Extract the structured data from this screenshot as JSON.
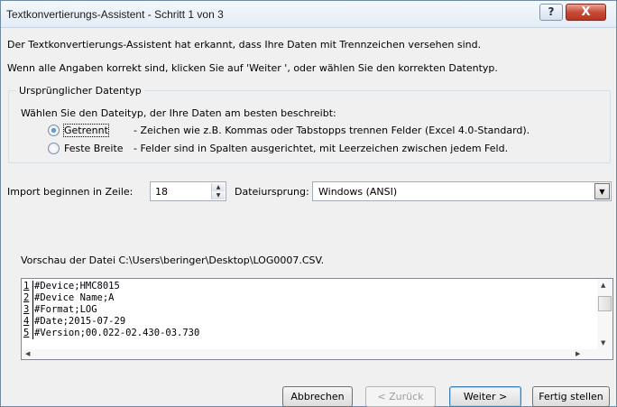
{
  "window": {
    "title": "Textkonvertierungs-Assistent - Schritt 1 von 3",
    "help_label": "?",
    "close_label": "X"
  },
  "intro": {
    "line1": "Der Textkonvertierungs-Assistent hat erkannt, dass Ihre Daten mit Trennzeichen versehen sind.",
    "line2": "Wenn alle Angaben korrekt sind, klicken Sie auf 'Weiter ', oder wählen Sie den korrekten Datentyp."
  },
  "datatype": {
    "group_label": "Ursprünglicher Datentyp",
    "instruction": "Wählen Sie den Dateityp, der Ihre Daten am besten beschreibt:",
    "options": [
      {
        "label": "Getrennt",
        "description": "- Zeichen wie z.B. Kommas oder Tabstopps trennen Felder (Excel 4.0-Standard).",
        "checked": true
      },
      {
        "label": "Feste Breite",
        "description": "- Felder sind in Spalten ausgerichtet, mit Leerzeichen zwischen jedem Feld.",
        "checked": false
      }
    ]
  },
  "import": {
    "start_row_label": "Import beginnen in Zeile:",
    "start_row_value": "18",
    "origin_label": "Dateiursprung:",
    "origin_value": "Windows (ANSI)"
  },
  "preview": {
    "label": "Vorschau der Datei C:\\Users\\beringer\\Desktop\\LOG0007.CSV.",
    "lines": [
      {
        "num": "1",
        "text": "#Device;HMC8015"
      },
      {
        "num": "2",
        "text": "#Device Name;A"
      },
      {
        "num": "3",
        "text": "#Format;LOG"
      },
      {
        "num": "4",
        "text": "#Date;2015-07-29"
      },
      {
        "num": "5",
        "text": "#Version;00.022-02.430-03.730"
      }
    ]
  },
  "buttons": {
    "cancel": "Abbrechen",
    "back": "< Zurück",
    "next": "Weiter >",
    "finish": "Fertig stellen"
  }
}
